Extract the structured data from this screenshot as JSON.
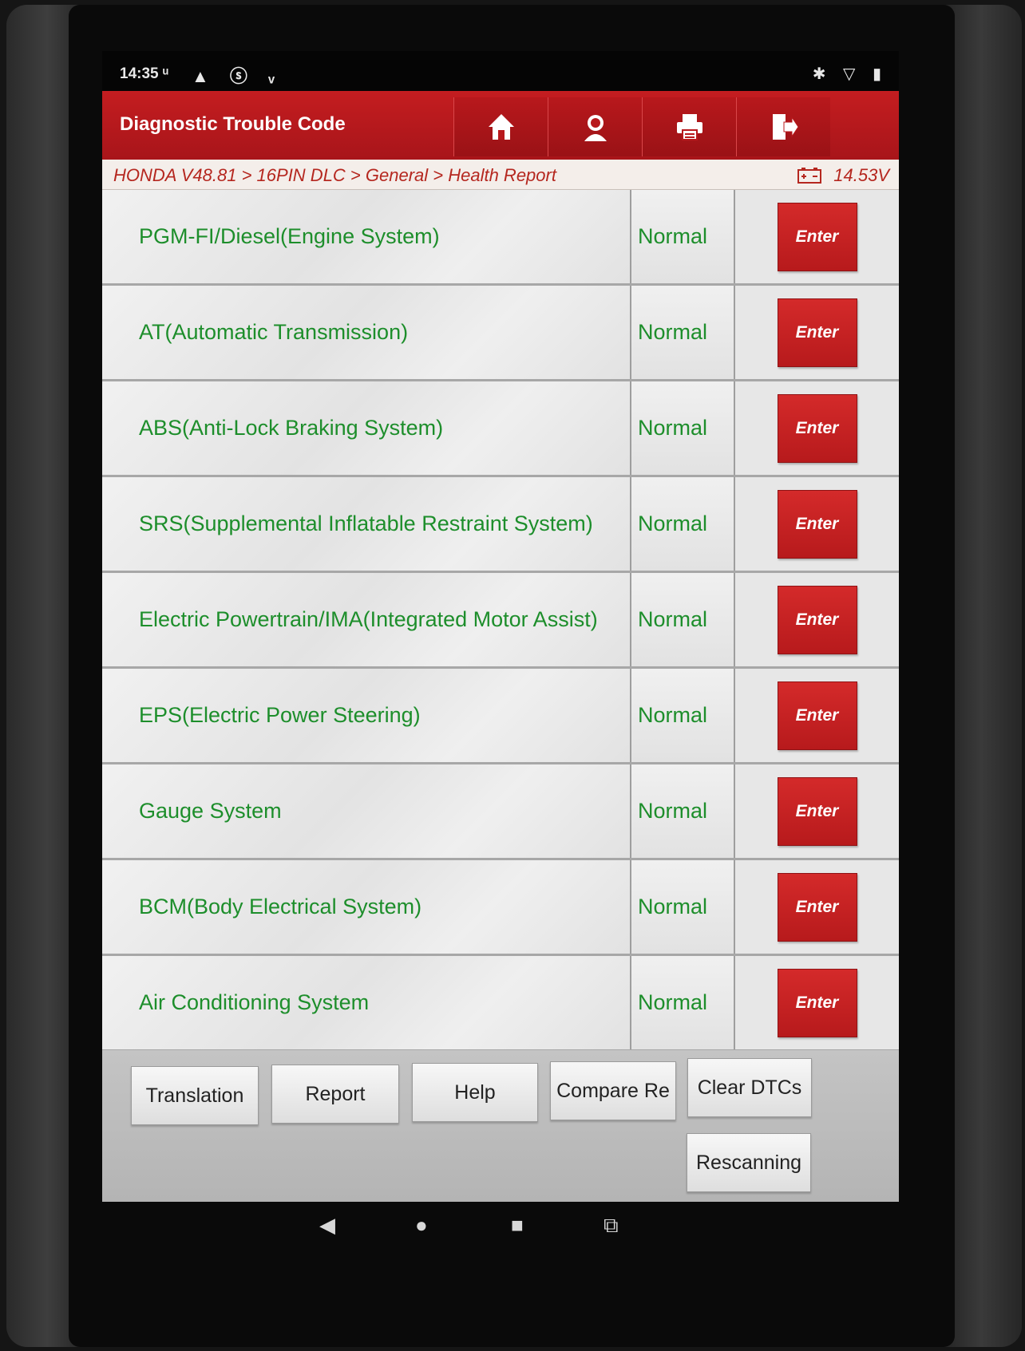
{
  "status_bar": {
    "time": "14:35 ᵘ",
    "left_icons": "▲ ⓢ ᵥ",
    "right_icons": "✱ ▽ ▮"
  },
  "header": {
    "title": "Diagnostic Trouble Code",
    "buttons": [
      {
        "icon": "home-icon"
      },
      {
        "icon": "user-support-icon"
      },
      {
        "icon": "printer-icon"
      },
      {
        "icon": "exit-icon"
      }
    ]
  },
  "breadcrumb": {
    "path": "HONDA V48.81 > 16PIN DLC > General > Health Report",
    "voltage": "14.53V",
    "battery_icon": "battery-icon"
  },
  "systems": [
    {
      "name": "PGM-FI/Diesel(Engine System)",
      "status": "Normal",
      "action": "Enter"
    },
    {
      "name": "AT(Automatic Transmission)",
      "status": "Normal",
      "action": "Enter"
    },
    {
      "name": "ABS(Anti-Lock Braking System)",
      "status": "Normal",
      "action": "Enter"
    },
    {
      "name": "SRS(Supplemental Inflatable Restraint System)",
      "status": "Normal",
      "action": "Enter"
    },
    {
      "name": "Electric Powertrain/IMA(Integrated Motor Assist)",
      "status": "Normal",
      "action": "Enter"
    },
    {
      "name": "EPS(Electric Power Steering)",
      "status": "Normal",
      "action": "Enter"
    },
    {
      "name": "Gauge System",
      "status": "Normal",
      "action": "Enter"
    },
    {
      "name": "BCM(Body Electrical System)",
      "status": "Normal",
      "action": "Enter"
    },
    {
      "name": "Air Conditioning System",
      "status": "Normal",
      "action": "Enter"
    }
  ],
  "footer": {
    "translation": "Translation",
    "report": "Report",
    "help": "Help",
    "compare": "Compare Re",
    "clear": "Clear DTCs",
    "rescan": "Rescanning"
  },
  "nav": {
    "back": "◀",
    "home": "●",
    "recents": "■",
    "screenshot": "⧉"
  },
  "colors": {
    "header_red": "#c41d20",
    "status_green": "#1d8e2b",
    "enter_red": "#c8221f",
    "breadcrumb_text": "#b5271f"
  }
}
